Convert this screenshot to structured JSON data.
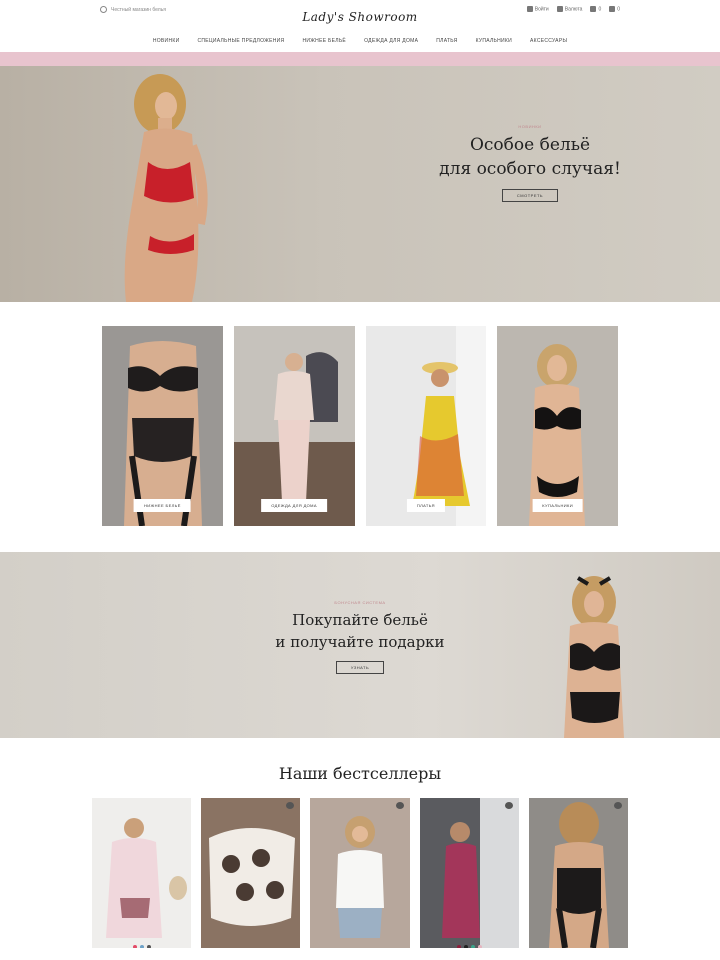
{
  "header": {
    "left_text": "Честный магазин белья",
    "logo": "Lady's Showroom",
    "right_items": [
      "Войти",
      "Валюта",
      "0",
      "0"
    ]
  },
  "nav": [
    "Новинки",
    "Специальные предложения",
    "Нижнее бельё",
    "Одежда для дома",
    "Платья",
    "Купальники",
    "Аксессуары"
  ],
  "hero": {
    "kicker": "Новинки",
    "title_line1": "Особое бельё",
    "title_line2": "для особого случая!",
    "button": "Смотреть"
  },
  "categories": [
    {
      "label": "Нижнее бельё"
    },
    {
      "label": "Одежда для дома"
    },
    {
      "label": "Платья"
    },
    {
      "label": "Купальники"
    }
  ],
  "promo": {
    "kicker": "Бонусная система",
    "title_line1": "Покупайте бельё",
    "title_line2": "и получайте подарки",
    "button": "Узнать"
  },
  "bestsellers": {
    "title": "Наши бестселлеры"
  },
  "colors": {
    "accent_pink": "#e8c4ce",
    "text_dark": "#222222"
  }
}
